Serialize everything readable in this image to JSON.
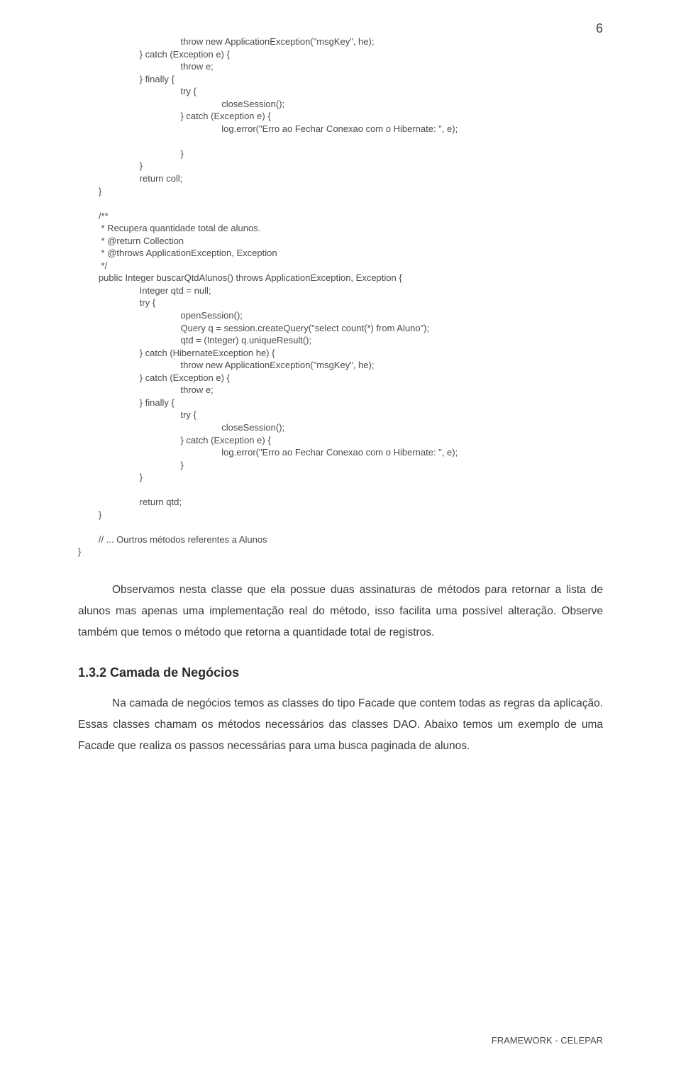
{
  "page_number": "6",
  "code_block_1": "                                        throw new ApplicationException(\"msgKey\", he);\n                        } catch (Exception e) {\n                                        throw e;\n                        } finally {\n                                        try {\n                                                        closeSession();\n                                        } catch (Exception e) {\n                                                        log.error(\"Erro ao Fechar Conexao com o Hibernate: \", e);\n\n                                        }\n                        }\n                        return coll;\n        }\n\n        /**\n         * Recupera quantidade total de alunos.\n         * @return Collection\n         * @throws ApplicationException, Exception\n         */\n        public Integer buscarQtdAlunos() throws ApplicationException, Exception {\n                        Integer qtd = null;\n                        try {\n                                        openSession();\n                                        Query q = session.createQuery(\"select count(*) from Aluno\");\n                                        qtd = (Integer) q.uniqueResult();\n                        } catch (HibernateException he) {\n                                        throw new ApplicationException(\"msgKey\", he);\n                        } catch (Exception e) {\n                                        throw e;\n                        } finally {\n                                        try {\n                                                        closeSession();\n                                        } catch (Exception e) {\n                                                        log.error(\"Erro ao Fechar Conexao com o Hibernate: \", e);\n                                        }\n                        }\n\n                        return qtd;\n        }\n\n        // ... Ourtros métodos referentes a Alunos\n}",
  "paragraph_1": "Observamos nesta classe que ela possue duas assinaturas de métodos para retornar a lista de alunos mas apenas uma implementação real do método, isso facilita uma possível alteração. Observe também que temos o método que retorna a quantidade total de registros.",
  "section_heading": "1.3.2 Camada de Negócios",
  "paragraph_2": "Na camada de negócios temos as classes do tipo Facade que contem todas as regras da aplicação. Essas classes chamam os métodos necessários das classes DAO. Abaixo temos um exemplo de uma Facade que realiza os passos necessárias para uma busca paginada de alunos.",
  "footer": "FRAMEWORK - CELEPAR"
}
